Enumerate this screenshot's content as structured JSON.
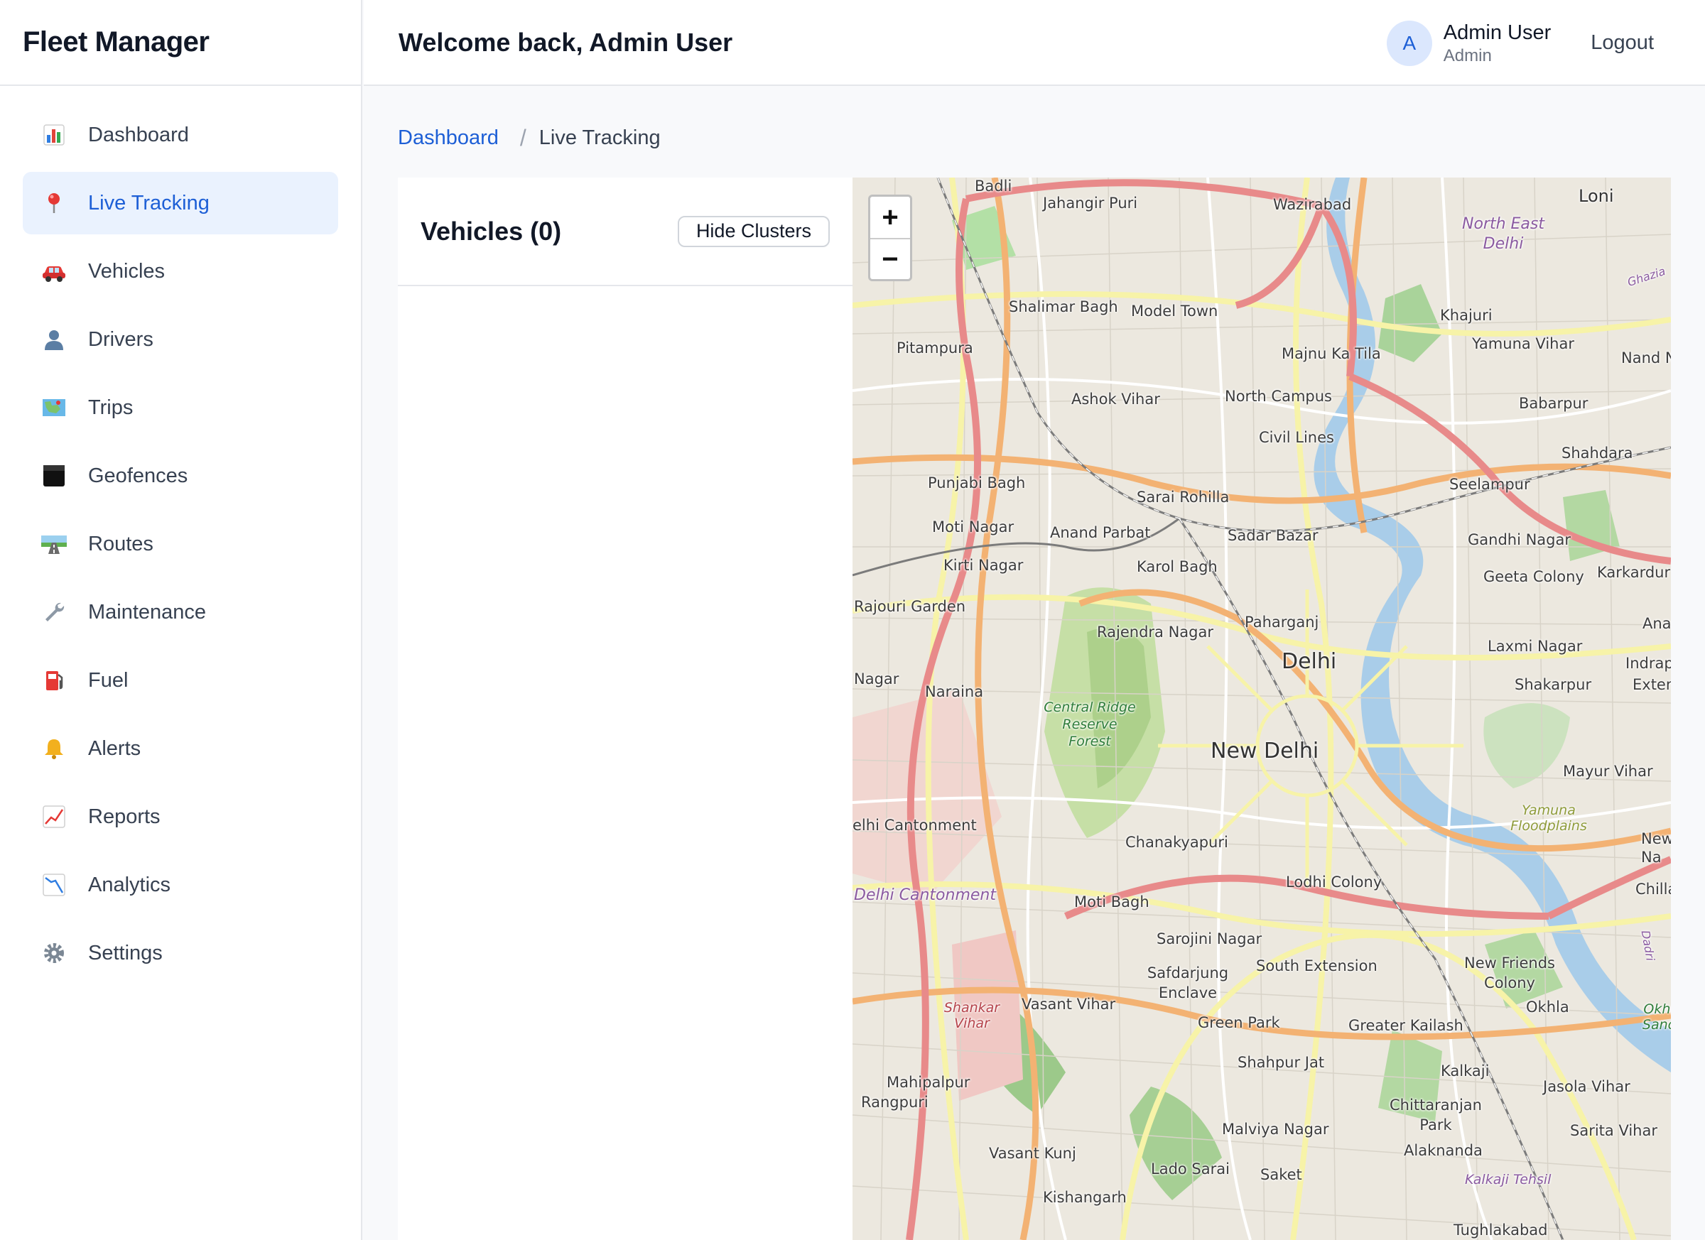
{
  "app": {
    "brand": "Fleet Manager"
  },
  "header": {
    "welcome": "Welcome back, Admin User",
    "user": {
      "initial": "A",
      "name": "Admin User",
      "role": "Admin"
    },
    "logout_label": "Logout"
  },
  "sidebar": {
    "items": [
      {
        "label": "Dashboard",
        "icon": "bar-chart-icon",
        "active": false
      },
      {
        "label": "Live Tracking",
        "icon": "map-pin-icon",
        "active": true
      },
      {
        "label": "Vehicles",
        "icon": "car-icon",
        "active": false
      },
      {
        "label": "Drivers",
        "icon": "user-icon",
        "active": false
      },
      {
        "label": "Trips",
        "icon": "map-icon",
        "active": false
      },
      {
        "label": "Geofences",
        "icon": "square-icon",
        "active": false
      },
      {
        "label": "Routes",
        "icon": "road-icon",
        "active": false
      },
      {
        "label": "Maintenance",
        "icon": "wrench-icon",
        "active": false
      },
      {
        "label": "Fuel",
        "icon": "fuel-pump-icon",
        "active": false
      },
      {
        "label": "Alerts",
        "icon": "bell-icon",
        "active": false
      },
      {
        "label": "Reports",
        "icon": "chart-up-icon",
        "active": false
      },
      {
        "label": "Analytics",
        "icon": "chart-down-icon",
        "active": false
      },
      {
        "label": "Settings",
        "icon": "gear-icon",
        "active": false
      }
    ]
  },
  "breadcrumb": {
    "parent": "Dashboard",
    "separator": "/",
    "current": "Live Tracking"
  },
  "vehicles_panel": {
    "title": "Vehicles (0)",
    "toggle_label": "Hide Clusters"
  },
  "map": {
    "zoom_in": "+",
    "zoom_out": "−",
    "labels": {
      "badli": "Badli",
      "jahangir_puri": "Jahangir Puri",
      "wazirabad": "Wazirabad",
      "loni": "Loni",
      "north_east_delhi": "North East Delhi",
      "shalimar_bagh": "Shalimar Bagh",
      "model_town": "Model Town",
      "khajuri": "Khajuri",
      "pitampura": "Pitampura",
      "majnu_ka_tila": "Majnu Ka Tila",
      "yamuna_vihar": "Yamuna Vihar",
      "nand_n": "Nand N",
      "ashok_vihar": "Ashok Vihar",
      "north_campus": "North Campus",
      "babarpur": "Babarpur",
      "civil_lines": "Civil Lines",
      "shahdara": "Shahdara",
      "punjabi_bagh": "Punjabi Bagh",
      "seelampur": "Seelampur",
      "sarai_rohilla": "Sarai Rohilla",
      "moti_nagar": "Moti Nagar",
      "anand_parbat": "Anand Parbat",
      "sadar_bazar": "Sadar Bazar",
      "gandhi_nagar": "Gandhi Nagar",
      "kirti_nagar": "Kirti Nagar",
      "karol_bagh": "Karol Bagh",
      "geeta_colony": "Geeta Colony",
      "karkardur": "Karkardur",
      "rajouri_garden": "Rajouri Garden",
      "paharganj": "Paharganj",
      "rajendra_nagar": "Rajendra Nagar",
      "ana": "Ana",
      "delhi": "Delhi",
      "laxmi_nagar": "Laxmi Nagar",
      "indrapr": "Indrapr",
      "nagar": "Nagar",
      "naraina": "Naraina",
      "shakarpur": "Shakarpur",
      "exten": "Exten",
      "central_ridge": "Central Ridge Reserve Forest",
      "new_delhi": "New Delhi",
      "mayur_vihar": "Mayur Vihar",
      "yamuna_floodplains": "Yamuna Floodplains",
      "delhi_cantonment": "elhi Cantonment",
      "chanakyapuri": "Chanakyapuri",
      "new_na": "New Na",
      "delhi_cantonment_area": "Delhi Cantonment",
      "lodhi_colony": "Lodhi Colony",
      "chilla": "Chilla",
      "moti_bagh": "Moti Bagh",
      "sarojini_nagar": "Sarojini Nagar",
      "new_friends_colony": "New Friends Colony",
      "safdarjung_enclave": "Safdarjung Enclave",
      "south_extension": "South Extension",
      "shankar_vihar": "Shankar Vihar",
      "vasant_vihar": "Vasant Vihar",
      "okhla": "Okhla",
      "okhla_sanc": "Okhl Sanc",
      "green_park": "Green Park",
      "greater_kailash": "Greater Kailash",
      "shahpur_jat": "Shahpur Jat",
      "kalkaji": "Kalkaji",
      "mahipalpur": "Mahipalpur",
      "rangpuri": "Rangpuri",
      "jasola_vihar": "Jasola Vihar",
      "chittaranjan_park": "Chittaranjan Park",
      "malviya_nagar": "Malviya Nagar",
      "sarita_vihar": "Sarita Vihar",
      "vasant_kunj": "Vasant Kunj",
      "alaknanda": "Alaknanda",
      "lado_sarai": "Lado Sarai",
      "saket": "Saket",
      "kalkaji_tehsil": "Kalkaji Tehsil",
      "kishangarh": "Kishangarh",
      "tughlakabad": "Tughlakabad",
      "ghazia": "Ghazia",
      "dadri": "Dadri"
    }
  }
}
